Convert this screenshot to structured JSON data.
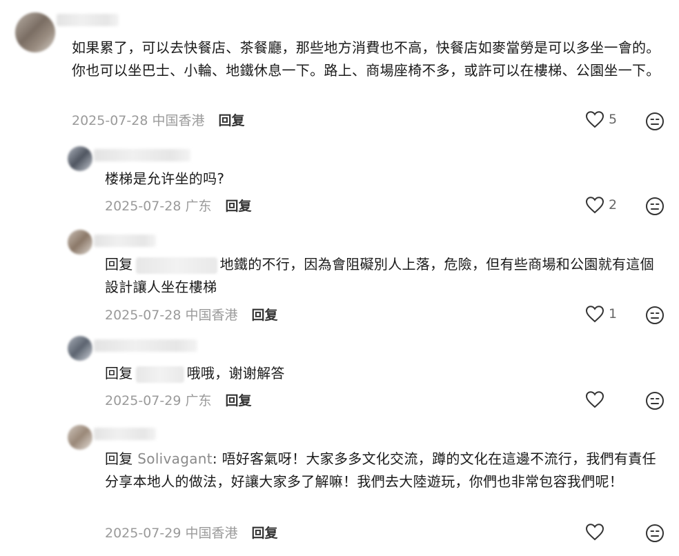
{
  "comments": [
    {
      "text": "如果累了，可以去快餐店、茶餐廳，那些地方消費也不高，快餐店如麥當勞是可以多坐一會的。你也可以坐巴士、小輪、地鐵休息一下。路上、商場座椅不多，或許可以在樓梯、公園坐一下。",
      "date": "2025-07-28",
      "location": "中国香港",
      "reply_label": "回复",
      "likes": "5"
    },
    {
      "text": "楼梯是允许坐的吗?",
      "date": "2025-07-28",
      "location": "广东",
      "reply_label": "回复",
      "likes": "2"
    },
    {
      "reply_prefix": "回复",
      "text": "地鐵的不行，因為會阻礙別人上落，危險，但有些商場和公園就有這個設計讓人坐在樓梯",
      "date": "2025-07-28",
      "location": "中国香港",
      "reply_label": "回复",
      "likes": "1"
    },
    {
      "reply_prefix": "回复",
      "text": "哦哦，谢谢解答",
      "date": "2025-07-29",
      "location": "广东",
      "reply_label": "回复",
      "likes": ""
    },
    {
      "reply_prefix": "回复",
      "mention": "Solivagant",
      "text": ": 唔好客氣呀！大家多多文化交流，蹲的文化在這邊不流行，我們有責任分享本地人的做法，好讓大家多了解嘛！我們去大陸遊玩，你們也非常包容我們呢！",
      "date": "2025-07-29",
      "location": "中国香港",
      "reply_label": "回复",
      "likes": ""
    }
  ],
  "icons": {
    "like": "heart-outline-icon",
    "dislike": "dislike-face-icon"
  }
}
